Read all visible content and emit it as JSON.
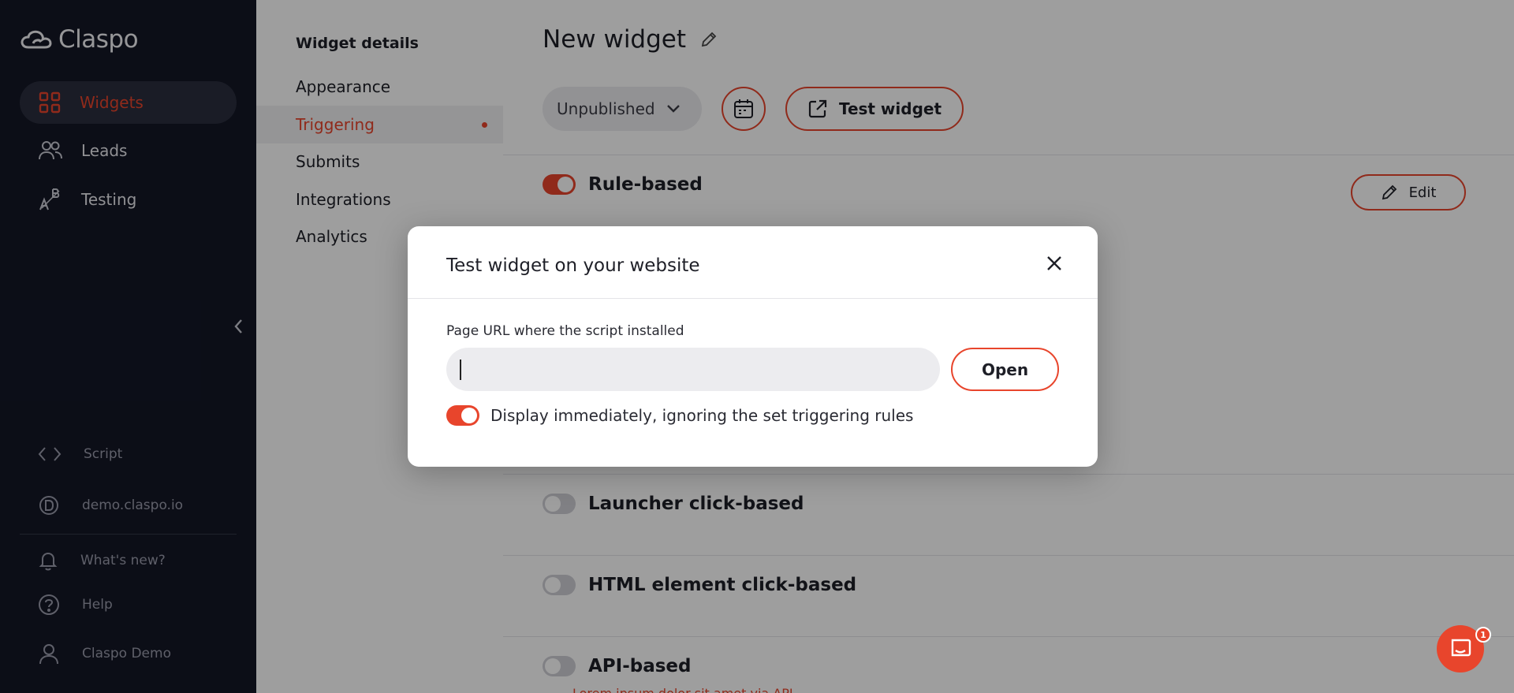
{
  "app": {
    "brand": "Claspo",
    "accent_color": "#e8452c",
    "sidebar_bg": "#141726"
  },
  "sidebar": {
    "items": [
      {
        "label": "Widgets",
        "icon": "grid-icon",
        "active": true
      },
      {
        "label": "Leads",
        "icon": "users-icon",
        "active": false
      },
      {
        "label": "Testing",
        "icon": "ab-test-icon",
        "active": false
      }
    ],
    "bottom": {
      "script": "Script",
      "domain": "demo.claspo.io",
      "whats_new": "What's new?",
      "help": "Help",
      "account": "Claspo Demo"
    }
  },
  "subnav": {
    "title": "Widget details",
    "items": [
      {
        "label": "Appearance",
        "active": false
      },
      {
        "label": "Triggering",
        "active": true
      },
      {
        "label": "Submits",
        "active": false
      },
      {
        "label": "Integrations",
        "active": false
      },
      {
        "label": "Analytics",
        "active": false
      }
    ]
  },
  "main": {
    "title": "New widget",
    "status": "Unpublished",
    "test_button": "Test widget",
    "edit_button": "Edit",
    "triggers": [
      {
        "label": "Rule-based",
        "enabled": true
      },
      {
        "label": "Launcher click-based",
        "enabled": false
      },
      {
        "label": "HTML element click-based",
        "enabled": false
      },
      {
        "label": "API-based",
        "enabled": false
      }
    ],
    "api_desc": "Lorem ipsum dolor sit amet via API"
  },
  "modal": {
    "title": "Test widget on your website",
    "field_label": "Page URL where the script installed",
    "url_value": "",
    "url_placeholder": "",
    "open_button": "Open",
    "display_toggle_label": "Display immediately, ignoring the set triggering rules",
    "display_toggle_on": true
  },
  "chat": {
    "badge": "1"
  }
}
